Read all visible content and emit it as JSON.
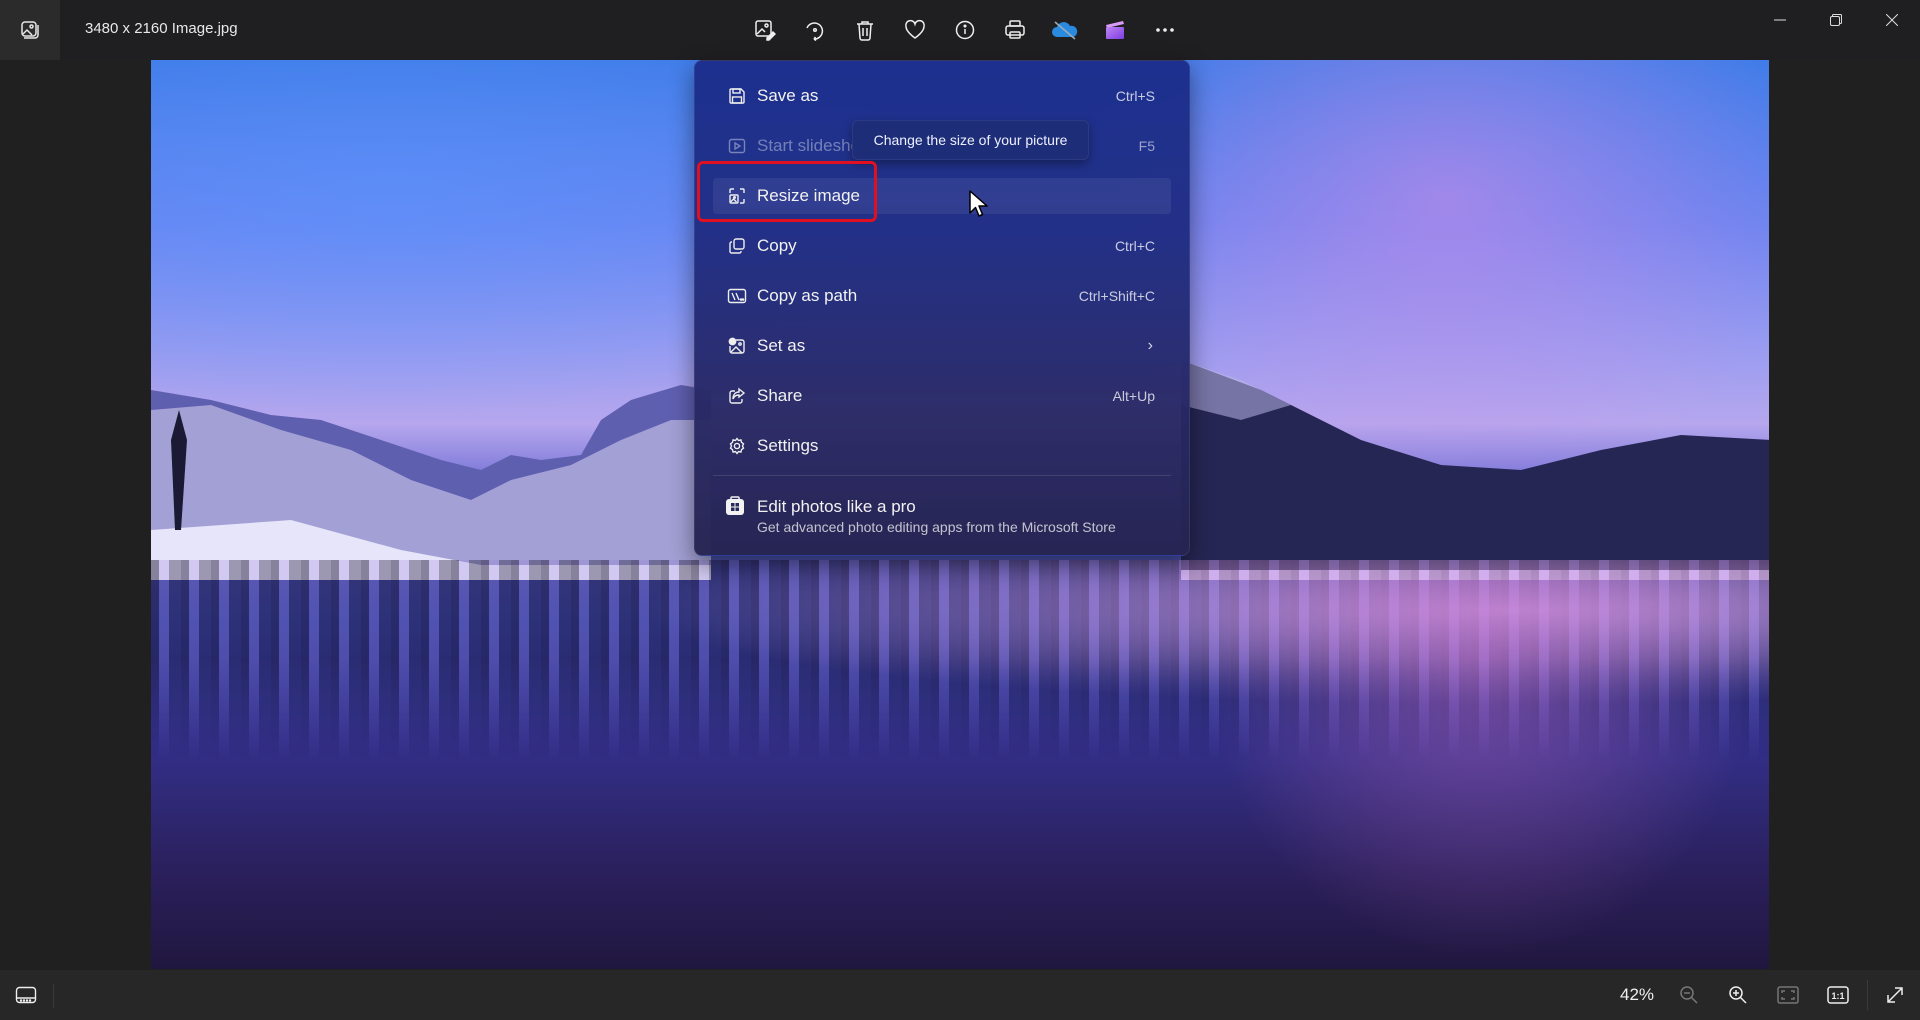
{
  "window": {
    "title": "3480 x 2160 Image.jpg",
    "controls": [
      "minimize-icon",
      "restore-icon",
      "close-icon"
    ]
  },
  "toolbar": {
    "buttons": [
      {
        "name": "edit-image",
        "icon": "edit-image-icon"
      },
      {
        "name": "rotate",
        "icon": "rotate-icon"
      },
      {
        "name": "delete",
        "icon": "trash-icon"
      },
      {
        "name": "favorite",
        "icon": "heart-icon"
      },
      {
        "name": "file-info",
        "icon": "info-icon"
      },
      {
        "name": "print",
        "icon": "printer-icon"
      },
      {
        "name": "onedrive",
        "icon": "onedrive-off-icon"
      },
      {
        "name": "clipchamp",
        "icon": "clipchamp-icon"
      },
      {
        "name": "see-more",
        "icon": "more-icon"
      }
    ]
  },
  "context_menu": {
    "items": [
      {
        "label": "Save as",
        "shortcut": "Ctrl+S",
        "icon": "save-icon",
        "disabled": false
      },
      {
        "label": "Start slideshow",
        "shortcut": "F5",
        "icon": "slideshow-icon",
        "disabled": true
      },
      {
        "label": "Resize image",
        "shortcut": "",
        "icon": "resize-image-icon",
        "disabled": false,
        "hovered": true
      },
      {
        "label": "Copy",
        "shortcut": "Ctrl+C",
        "icon": "copy-icon",
        "disabled": false
      },
      {
        "label": "Copy as path",
        "shortcut": "Ctrl+Shift+C",
        "icon": "copy-path-icon",
        "disabled": false
      },
      {
        "label": "Set as",
        "shortcut": "",
        "icon": "set-as-icon",
        "submenu": true,
        "disabled": false
      },
      {
        "label": "Share",
        "shortcut": "Alt+Up",
        "icon": "share-icon",
        "disabled": false
      },
      {
        "label": "Settings",
        "shortcut": "",
        "icon": "gear-icon",
        "disabled": false
      }
    ],
    "promo": {
      "title": "Edit photos like a pro",
      "subtitle": "Get advanced photo editing apps from the Microsoft Store",
      "icon": "store-icon"
    }
  },
  "tooltip": {
    "text": "Change the size of your picture"
  },
  "bottom_bar": {
    "zoom_level": "42%",
    "buttons": [
      "filmstrip-icon",
      "zoom-out-icon",
      "zoom-in-icon",
      "fit-window-icon",
      "actual-size-icon",
      "fullscreen-icon"
    ]
  },
  "colors": {
    "highlight_box": "#e01020",
    "menu_bg": "#1c2e8c"
  }
}
